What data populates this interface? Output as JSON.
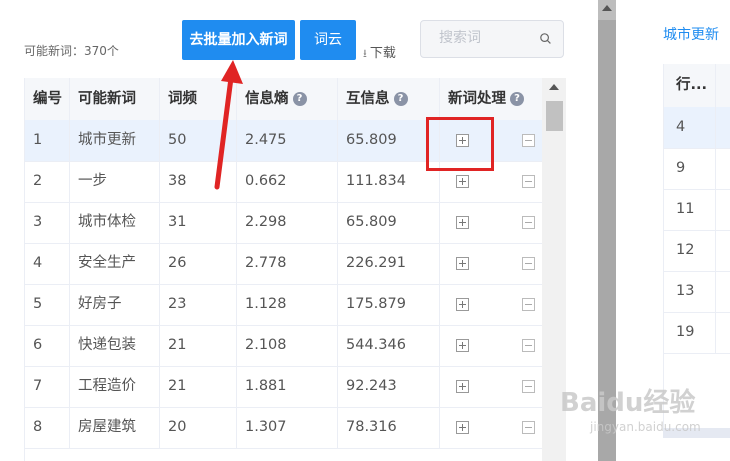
{
  "toolbar": {
    "count_label": "可能新词：370个",
    "batch_add_label": "去批量加入新词",
    "cloud_label": "词云",
    "download_label": "下载",
    "download_icon": "download-arrow-icon"
  },
  "search": {
    "placeholder": "搜索词",
    "icon": "search-icon"
  },
  "table": {
    "columns": [
      "编号",
      "可能新词",
      "词频",
      "信息熵",
      "互信息",
      "新词处理"
    ],
    "rows": [
      {
        "id": "1",
        "word": "城市更新",
        "freq": "50",
        "entropy": "2.475",
        "mi": "65.809"
      },
      {
        "id": "2",
        "word": "一步",
        "freq": "38",
        "entropy": "0.662",
        "mi": "111.834"
      },
      {
        "id": "3",
        "word": "城市体检",
        "freq": "31",
        "entropy": "2.298",
        "mi": "65.809"
      },
      {
        "id": "4",
        "word": "安全生产",
        "freq": "26",
        "entropy": "2.778",
        "mi": "226.291"
      },
      {
        "id": "5",
        "word": "好房子",
        "freq": "23",
        "entropy": "1.128",
        "mi": "175.879"
      },
      {
        "id": "6",
        "word": "快递包装",
        "freq": "21",
        "entropy": "2.108",
        "mi": "544.346"
      },
      {
        "id": "7",
        "word": "工程造价",
        "freq": "21",
        "entropy": "1.881",
        "mi": "92.243"
      },
      {
        "id": "8",
        "word": "房屋建筑",
        "freq": "20",
        "entropy": "1.307",
        "mi": "78.316"
      }
    ]
  },
  "right_panel": {
    "title": "城市更新",
    "header": "行...",
    "rows": [
      "4",
      "9",
      "11",
      "12",
      "13",
      "19"
    ]
  },
  "watermark": {
    "text": "Baidu经验",
    "sub": "jingyan.baidu.com"
  },
  "colors": {
    "primary": "#1f8cf0",
    "annotation": "#e02424",
    "row_highlight": "#eaf2fd"
  }
}
